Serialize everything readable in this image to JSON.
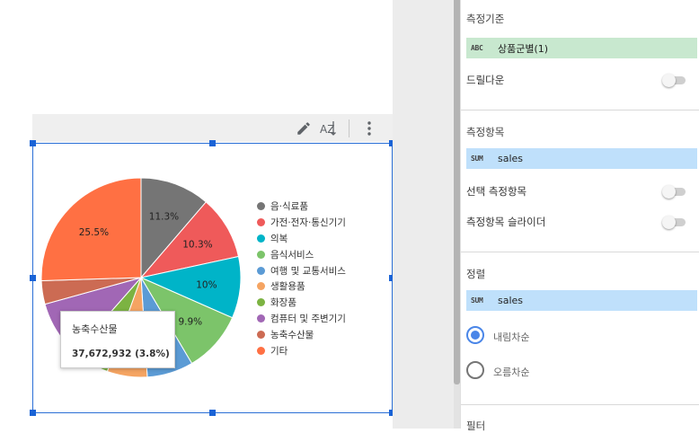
{
  "chart_toolbar": {
    "edit_icon": "pencil-icon",
    "sort_icon": "sort-az-icon",
    "more_icon": "more-vert-icon",
    "sort_label": "AZ"
  },
  "chart_data": {
    "type": "pie",
    "title": "",
    "slices": [
      {
        "label": "음·식료품",
        "value": 11.3,
        "color": "#757575",
        "show_label": "11.3%"
      },
      {
        "label": "가전·전자·통신기기",
        "value": 10.3,
        "color": "#ef5a5a",
        "show_label": "10.3%"
      },
      {
        "label": "의복",
        "value": 10.0,
        "color": "#00b4c8",
        "show_label": "10%"
      },
      {
        "label": "음식서비스",
        "value": 9.9,
        "color": "#7cc46a",
        "show_label": "9.9%"
      },
      {
        "label": "여행 및 교통서비스",
        "value": 7.5,
        "color": "#5b9bd5",
        "show_label": ""
      },
      {
        "label": "생활용품",
        "value": 6.5,
        "color": "#f5a462",
        "show_label": ""
      },
      {
        "label": "화장품",
        "value": 6.0,
        "color": "#7cb342",
        "show_label": ""
      },
      {
        "label": "컴퓨터 및 주변기기",
        "value": 9.2,
        "color": "#a167b5",
        "show_label": ""
      },
      {
        "label": "농축수산물",
        "value": 3.8,
        "color": "#cc6b53",
        "show_label": ""
      },
      {
        "label": "기타",
        "value": 25.5,
        "color": "#ff7043",
        "show_label": "25.5%"
      }
    ],
    "legend_position": "right"
  },
  "tooltip": {
    "title": "농축수산물",
    "value": "37,672,932 (3.8%)"
  },
  "panel": {
    "dimension_label": "측정기준",
    "dimension_chip": {
      "tag": "ABC",
      "text": "상품군별(1)"
    },
    "drilldown_label": "드릴다운",
    "metric_label": "측정항목",
    "metric_chip": {
      "tag": "SUM",
      "text": "sales"
    },
    "optional_metric_label": "선택 측정항목",
    "metric_slider_label": "측정항목 슬라이더",
    "sort_label": "정렬",
    "sort_chip": {
      "tag": "SUM",
      "text": "sales"
    },
    "descending_label": "내림차순",
    "ascending_label": "오름차순",
    "filter_label": "필터"
  },
  "colors": {
    "selection": "#1a63d6",
    "radio_active": "#4a86e8",
    "dimension_chip": "#c8e8cf",
    "metric_chip": "#bfe0fb"
  }
}
